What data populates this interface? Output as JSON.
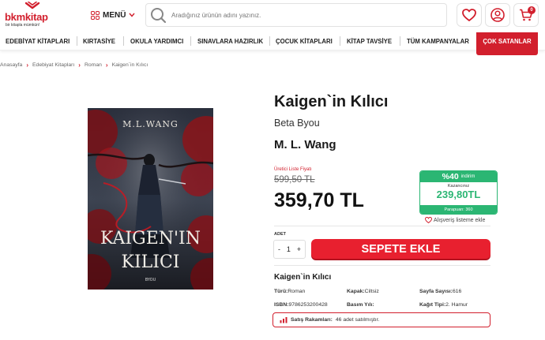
{
  "brand": {
    "name": "bkmkitap",
    "slogan": "bir kitapla mümkün!"
  },
  "header": {
    "menu_label": "MENÜ",
    "search_placeholder": "Aradığınız ürünün adını yazınız.",
    "cart_count": "0"
  },
  "nav": {
    "items": [
      "EDEBİYAT KİTAPLARI",
      "KIRTASİYE",
      "OKULA YARDIMCI",
      "SINAVLARA HAZIRLIK",
      "ÇOCUK KİTAPLARI",
      "KİTAP TAVSİYE",
      "TÜM KAMPANYALAR"
    ],
    "highlight": "ÇOK SATANLAR"
  },
  "breadcrumb": [
    "Anasayfa",
    "Edebiyat Kitapları",
    "Roman",
    "Kaigen`in Kılıcı"
  ],
  "cover": {
    "author_text": "M.L.WANG",
    "title_line1": "KAIGEN'IN",
    "title_line2": "KILICI",
    "publisher_mark": "BYOU"
  },
  "product": {
    "title": "Kaigen`in Kılıcı",
    "publisher": "Beta Byou",
    "author": "M. L. Wang",
    "list_price_label": "Üretici Liste Fiyatı",
    "list_price": "599,50 TL",
    "price": "359,70 TL",
    "discount_pct": "%40",
    "discount_word": "indirim",
    "savings_label": "Kazancınız",
    "savings": "239,80TL",
    "points": "Parapuan: 360",
    "wishlist": "Alışveriş listeme ekle",
    "qty_label": "ADET",
    "qty_minus": "-",
    "qty_value": "1",
    "qty_plus": "+",
    "add_to_cart": "SEPETE EKLE"
  },
  "details": {
    "title": "Kaigen`in Kılıcı",
    "specs": [
      {
        "label": "Türü:",
        "value": "Roman"
      },
      {
        "label": "Kapak:",
        "value": "Ciltsiz"
      },
      {
        "label": "Sayfa Sayısı:",
        "value": "616"
      },
      {
        "label": "ISBN:",
        "value": "9786253200428"
      },
      {
        "label": "Basım Yılı:",
        "value": ""
      },
      {
        "label": "Kağıt Tipi:",
        "value": "2. Hamur"
      }
    ],
    "sales_label": "Satış Rakamları:",
    "sales_value": "46 adet satılmıştır."
  },
  "colors": {
    "brand_red": "#d21f2d",
    "discount_green": "#2bb673"
  }
}
